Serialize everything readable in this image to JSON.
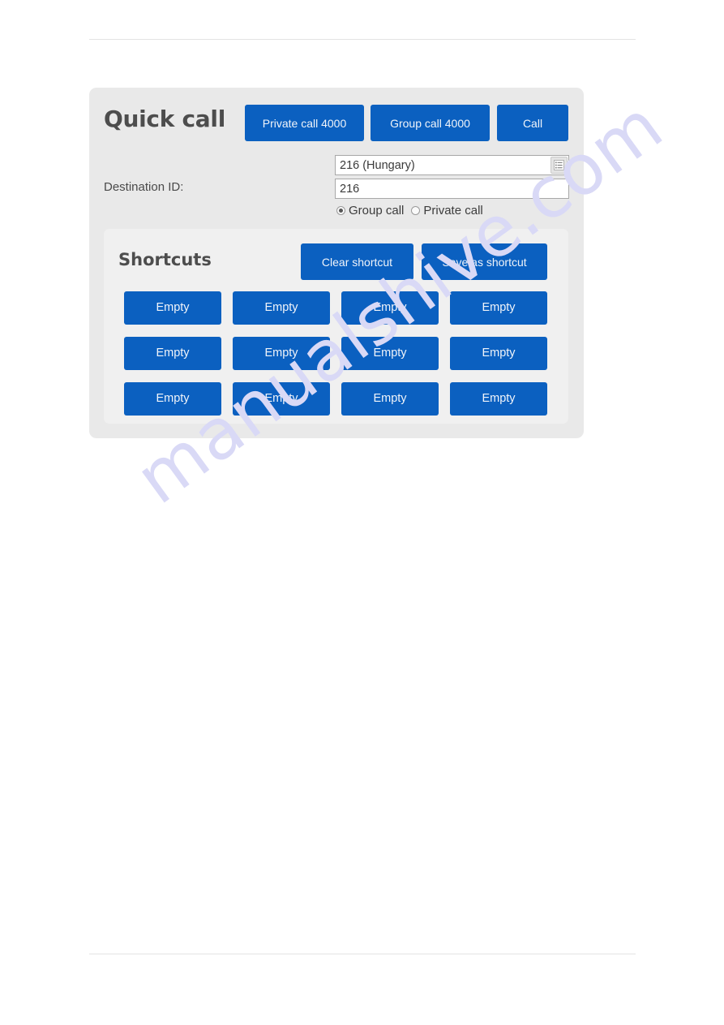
{
  "watermark": {
    "text": "manualshive.com"
  },
  "colors": {
    "accent_blue": "#0b60c0",
    "card_bg": "#e9e9e9",
    "panel_bg": "#f0f0f0",
    "title_gray": "#4d4d4d",
    "watermark": "#d9d9f6"
  },
  "quick_call": {
    "title": "Quick call",
    "buttons": [
      {
        "id": "private-4000",
        "label": "Private call 4000"
      },
      {
        "id": "group-4000",
        "label": "Group call 4000"
      },
      {
        "id": "call",
        "label": "Call"
      }
    ],
    "destination": {
      "label": "Destination ID:",
      "country_field": {
        "value": "216 (Hungary)",
        "placeholder": "",
        "icon": "list-icon"
      },
      "id_field": {
        "value": "216",
        "placeholder": ""
      },
      "call_type": {
        "options": [
          {
            "label": "Group call",
            "selected": true
          },
          {
            "label": "Private call",
            "selected": false
          }
        ]
      }
    }
  },
  "shortcuts": {
    "title": "Shortcuts",
    "actions": [
      {
        "id": "clear-shortcut",
        "label": "Clear shortcut"
      },
      {
        "id": "save-shortcut",
        "label": "Save as shortcut"
      }
    ],
    "slots": [
      {
        "label": "Empty"
      },
      {
        "label": "Empty"
      },
      {
        "label": "Empty"
      },
      {
        "label": "Empty"
      },
      {
        "label": "Empty"
      },
      {
        "label": "Empty"
      },
      {
        "label": "Empty"
      },
      {
        "label": "Empty"
      },
      {
        "label": "Empty"
      },
      {
        "label": "Empty"
      },
      {
        "label": "Empty"
      },
      {
        "label": "Empty"
      }
    ]
  }
}
